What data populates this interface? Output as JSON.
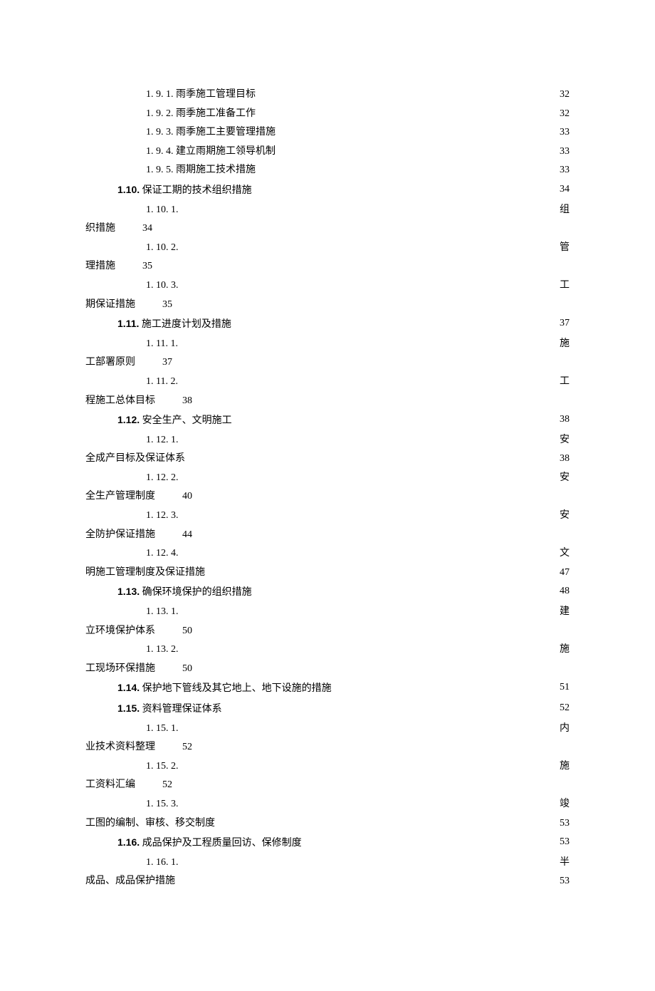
{
  "toc": [
    {
      "kind": "simple",
      "indent": "l3",
      "num": "1. 9. 1.",
      "title": "雨季施工管理目标",
      "page": "32"
    },
    {
      "kind": "simple",
      "indent": "l3",
      "num": "1. 9. 2.",
      "title": "雨季施工准备工作",
      "page": "32"
    },
    {
      "kind": "simple",
      "indent": "l3",
      "num": "1. 9. 3.",
      "title": "雨季施工主要管理措施",
      "page": "33"
    },
    {
      "kind": "simple",
      "indent": "l3",
      "num": "1. 9. 4.",
      "title": "建立雨期施工领导机制",
      "page": "33"
    },
    {
      "kind": "simple",
      "indent": "l3",
      "num": "1. 9. 5.",
      "title": "雨期施工技术措施",
      "page": "33"
    },
    {
      "kind": "l2",
      "indent": "l2",
      "num": "1.10.",
      "title": "保证工期的技术组织措施",
      "page": "34"
    },
    {
      "kind": "wrap",
      "indent": "l3",
      "num": "1. 10. 1.",
      "tail": "组",
      "cont": "织措施",
      "page": "34"
    },
    {
      "kind": "wrap",
      "indent": "l3",
      "num": "1. 10. 2.",
      "tail": "管",
      "cont": "理措施",
      "page": "35"
    },
    {
      "kind": "wrap",
      "indent": "l3",
      "num": "1. 10. 3.",
      "tail": "工",
      "cont": "期保证措施",
      "page": "35"
    },
    {
      "kind": "l2",
      "indent": "l2",
      "num": "1.11.",
      "title": "施工进度计划及措施",
      "page": "37"
    },
    {
      "kind": "wrap",
      "indent": "l3",
      "num": "1. 11. 1.",
      "tail": "施",
      "cont": "工部署原则",
      "page": "37"
    },
    {
      "kind": "wrap",
      "indent": "l3",
      "num": "1. 11. 2.",
      "tail": "工",
      "cont": "程施工总体目标",
      "page": "38"
    },
    {
      "kind": "l2",
      "indent": "l2",
      "num": "1.12.",
      "title": "安全生产、文明施工",
      "page": "38"
    },
    {
      "kind": "wrap2",
      "indent": "l3",
      "num": "1. 12. 1.",
      "tail": "安",
      "cont": "全成产目标及保证体系",
      "page": "38"
    },
    {
      "kind": "wrap",
      "indent": "l3",
      "num": "1. 12. 2.",
      "tail": "安",
      "cont": "全生产管理制度",
      "page": "40"
    },
    {
      "kind": "wrap",
      "indent": "l3",
      "num": "1. 12. 3.",
      "tail": "安",
      "cont": "全防护保证措施",
      "page": "44"
    },
    {
      "kind": "wrap2",
      "indent": "l3",
      "num": "1. 12. 4.",
      "tail": "文",
      "cont": "明施工管理制度及保证措施",
      "page": "47"
    },
    {
      "kind": "l2",
      "indent": "l2",
      "num": "1.13.",
      "title": "确保环境保护的组织措施",
      "page": "48"
    },
    {
      "kind": "wrap",
      "indent": "l3",
      "num": "1. 13. 1.",
      "tail": "建",
      "cont": "立环境保护体系",
      "page": "50"
    },
    {
      "kind": "wrap",
      "indent": "l3",
      "num": "1. 13. 2.",
      "tail": "施",
      "cont": "工现场环保措施",
      "page": "50"
    },
    {
      "kind": "l2",
      "indent": "l2",
      "num": "1.14.",
      "title": "保护地下管线及其它地上、地下设施的措施",
      "page": "51"
    },
    {
      "kind": "l2",
      "indent": "l2",
      "num": "1.15.",
      "title": "资料管理保证体系",
      "page": "52"
    },
    {
      "kind": "wrap",
      "indent": "l3",
      "num": "1. 15. 1.",
      "tail": "内",
      "cont": "业技术资料整理",
      "page": "52"
    },
    {
      "kind": "wrap",
      "indent": "l3",
      "num": "1. 15. 2.",
      "tail": "施",
      "cont": "工资料汇编",
      "page": "52"
    },
    {
      "kind": "wrap2",
      "indent": "l3",
      "num": "1. 15. 3.",
      "tail": "竣",
      "cont": "工图的编制、审核、移交制度",
      "page": "53"
    },
    {
      "kind": "l2",
      "indent": "l2",
      "num": "1.16.",
      "title": "成品保护及工程质量回访、保修制度",
      "page": "53"
    },
    {
      "kind": "wrap2",
      "indent": "l3",
      "num": "1. 16. 1.",
      "tail": "半",
      "cont": "成品、成品保护措施",
      "page": "53"
    }
  ]
}
